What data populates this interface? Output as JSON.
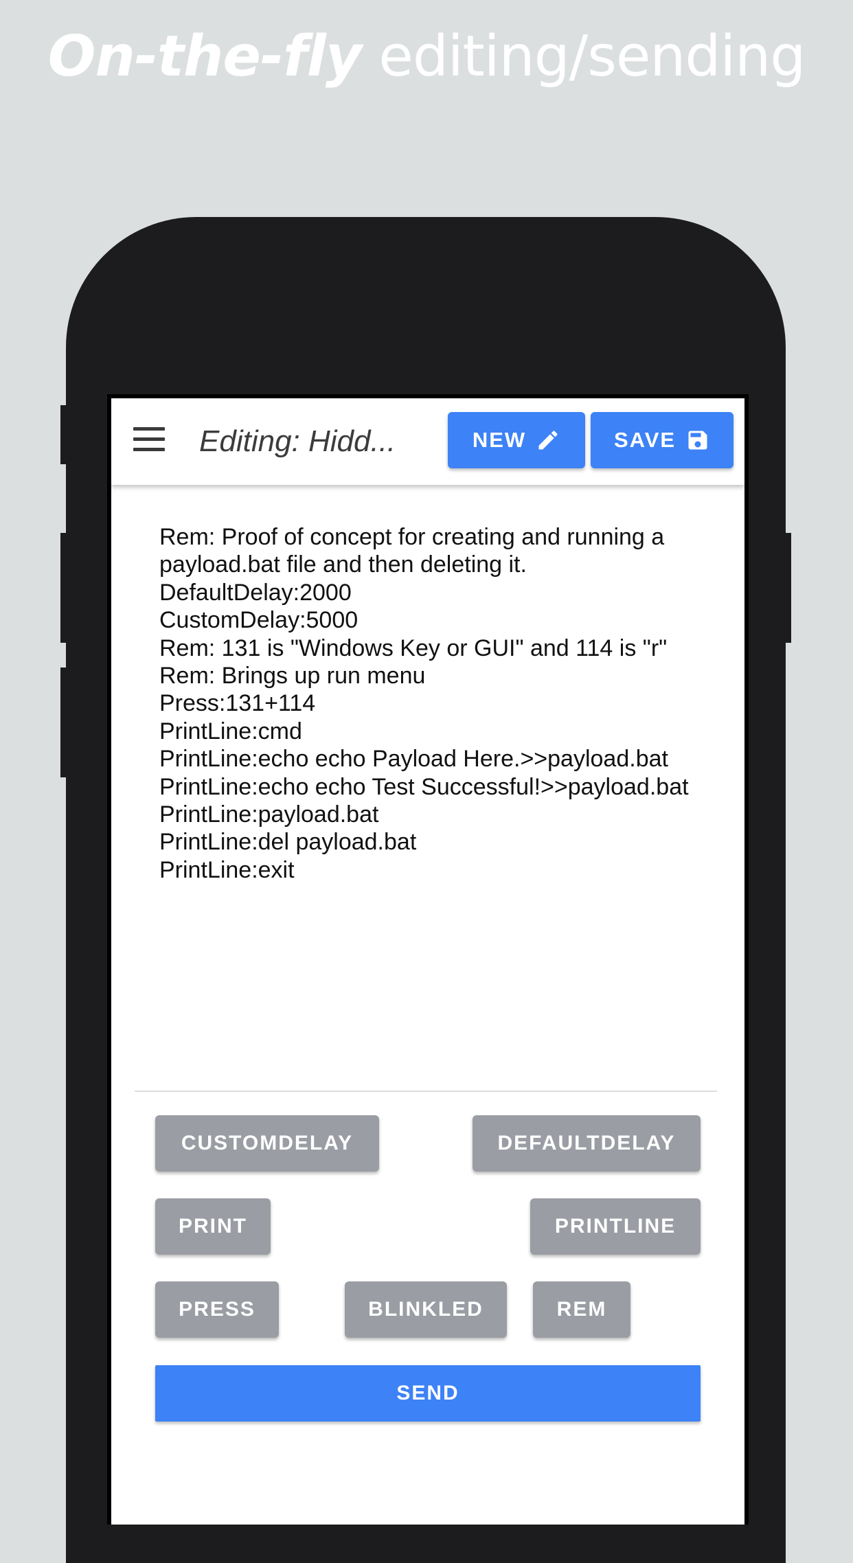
{
  "headline": {
    "bold": "On-the-fly",
    "rest": " editing/sending"
  },
  "appbar": {
    "title": "Editing: Hidd...",
    "new_label": "NEW",
    "save_label": "SAVE",
    "icons": {
      "menu": "hamburger-menu-icon",
      "new": "pencil-icon",
      "save": "floppy-disk-icon"
    }
  },
  "editor": {
    "script": "Rem: Proof of concept for creating and running a payload.bat file and then deleting it.\nDefaultDelay:2000\nCustomDelay:5000\nRem: 131 is \"Windows Key or GUI\" and 114 is \"r\"\nRem: Brings up run menu\nPress:131+114\nPrintLine:cmd\nPrintLine:echo echo Payload Here.>>payload.bat\nPrintLine:echo echo Test Successful!>>payload.bat\nPrintLine:payload.bat\nPrintLine:del payload.bat\nPrintLine:exit"
  },
  "commands": {
    "customdelay": "CUSTOMDELAY",
    "defaultdelay": "DEFAULTDELAY",
    "print": "PRINT",
    "printline": "PRINTLINE",
    "press": "PRESS",
    "blinkled": "BLINKLED",
    "rem": "REM",
    "send": "SEND"
  },
  "colors": {
    "accent": "#3d82f6",
    "command_button": "#9a9da3",
    "background": "#dcdfe0",
    "phone_body": "#1c1c1e"
  }
}
